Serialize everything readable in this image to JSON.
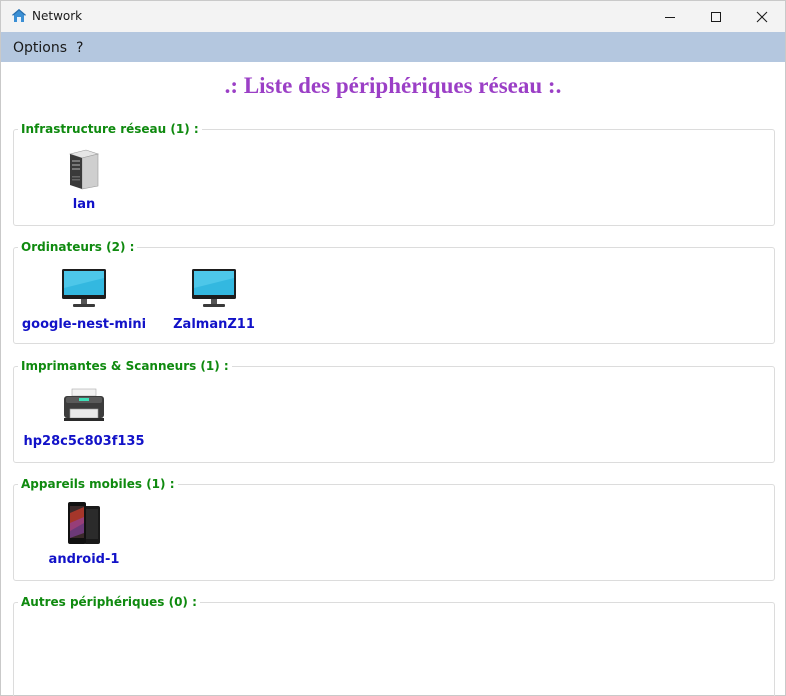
{
  "window": {
    "title": "Network"
  },
  "menu": {
    "options": "Options",
    "help": "?"
  },
  "heading": ".: Liste des périphériques réseau :.",
  "groups": [
    {
      "legend": "Infrastructure réseau (1) :",
      "devices": [
        {
          "label": "lan",
          "icon": "server-icon"
        }
      ]
    },
    {
      "legend": "Ordinateurs (2) :",
      "devices": [
        {
          "label": "google-nest-mini",
          "icon": "monitor-icon"
        },
        {
          "label": "ZalmanZ11",
          "icon": "monitor-icon"
        }
      ]
    },
    {
      "legend": "Imprimantes & Scanneurs (1) :",
      "devices": [
        {
          "label": "hp28c5c803f135",
          "icon": "printer-icon"
        }
      ]
    },
    {
      "legend": "Appareils mobiles (1) :",
      "devices": [
        {
          "label": "android-1",
          "icon": "smartphone-icon"
        }
      ]
    },
    {
      "legend": "Autres périphériques (0) :",
      "devices": []
    }
  ],
  "colors": {
    "heading": "#9b3fc6",
    "legend": "#0f8a0f",
    "device_label": "#1212c8",
    "menubar": "#b4c7df"
  }
}
